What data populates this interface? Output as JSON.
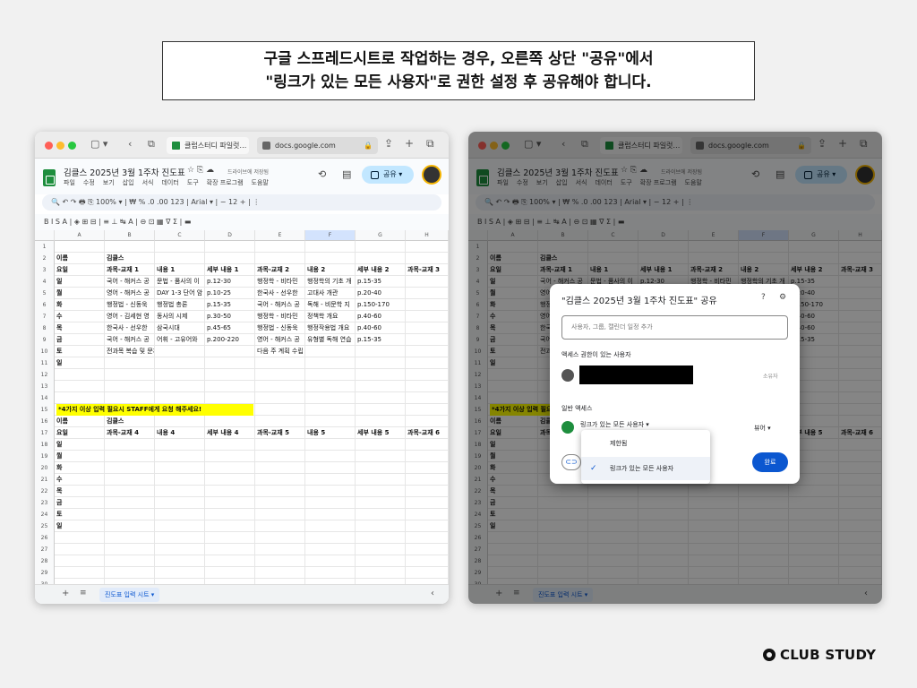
{
  "banner": {
    "line1": "구글 스프레드시트로 작업하는 경우, 오른쪽 상단 \"공유\"에서",
    "line2": "\"링크가 있는 모든 사용자\"로 권한 설정 후 공유해야 합니다."
  },
  "browser": {
    "tab1": "클럽스터디 파일럿…",
    "tab2": "docs.google.com"
  },
  "sheet": {
    "title": "김클스 2025년 3월 1주차 진도표",
    "saved": "드라이브에 저장됨",
    "menus": [
      "파일",
      "수정",
      "보기",
      "삽입",
      "서식",
      "데이터",
      "도구",
      "확장 프로그램",
      "도움말"
    ],
    "share_label": "공유",
    "toolbar1": "🔍  ↶  ↷  🖶  ⎘    100%  ▾  |  ₩  %  .0  .00  123  |  Arial   ▾  |  −  12  +  |  ⋮",
    "toolbar2": "B   I   S   A  |  ◈  ⊞  ⊟  |  ≡  ⊥  ↹  A  |  ⊖  ⊡  ▦  ∇  Σ  |  ▬",
    "cols": [
      "A",
      "B",
      "C",
      "D",
      "E",
      "F",
      "G",
      "H"
    ],
    "rows": [
      {
        "n": "1",
        "c": [
          "",
          "",
          "",
          "",
          "",
          "",
          "",
          ""
        ]
      },
      {
        "n": "2",
        "c": [
          "이름",
          "김클스",
          "",
          "",
          "",
          "",
          "",
          ""
        ]
      },
      {
        "n": "3",
        "c": [
          "요일",
          "과목-교재 1",
          "내용 1",
          "세부 내용 1",
          "과목-교재 2",
          "내용 2",
          "세부 내용 2",
          "과목-교재 3"
        ]
      },
      {
        "n": "4",
        "c": [
          "일",
          "국어 - 해커스 공",
          "문법 - 품사의 이",
          "p.12-30",
          "행정학 - 비타민",
          "행정학의 기초 개",
          "p.15-35",
          ""
        ]
      },
      {
        "n": "5",
        "c": [
          "월",
          "영어 - 해커스 공",
          "DAY 1-3 단어 암",
          "p.10-25",
          "한국사 - 선우한",
          "고대사 개관",
          "p.20-40",
          ""
        ]
      },
      {
        "n": "6",
        "c": [
          "화",
          "행정법 - 신동욱",
          "행정법 총론",
          "p.15-35",
          "국어 - 해커스 공",
          "독해 - 비문학 지",
          "p.150-170",
          ""
        ]
      },
      {
        "n": "7",
        "c": [
          "수",
          "영어 - 김세현 영",
          "동사의 시제",
          "p.30-50",
          "행정학 - 비타민",
          "정책학 개요",
          "p.40-60",
          ""
        ]
      },
      {
        "n": "8",
        "c": [
          "목",
          "한국사 - 선우한",
          "삼국시대",
          "p.45-65",
          "행정법 - 신동욱",
          "행정작용법 개요",
          "p.40-60",
          ""
        ]
      },
      {
        "n": "9",
        "c": [
          "금",
          "국어 - 해커스 공",
          "어휘 - 고유어와",
          "p.200-220",
          "영어 - 해커스 공",
          "유형별 독해 연습",
          "p.15-35",
          ""
        ]
      },
      {
        "n": "10",
        "c": [
          "토",
          "전과목 복습 및 문제풀이",
          "",
          "",
          "다음 주 계획 수립",
          "",
          "",
          ""
        ]
      },
      {
        "n": "11",
        "c": [
          "일",
          "",
          "",
          "",
          "",
          "",
          "",
          ""
        ]
      },
      {
        "n": "12",
        "c": [
          "",
          "",
          "",
          "",
          "",
          "",
          "",
          ""
        ]
      },
      {
        "n": "13",
        "c": [
          "",
          "",
          "",
          "",
          "",
          "",
          "",
          ""
        ]
      },
      {
        "n": "14",
        "c": [
          "",
          "",
          "",
          "",
          "",
          "",
          "",
          ""
        ]
      },
      {
        "n": "15",
        "c": [
          "",
          "",
          "",
          "",
          "",
          "",
          "",
          ""
        ]
      },
      {
        "n": "16",
        "c": [
          "이름",
          "김클스",
          "",
          "",
          "",
          "",
          "",
          ""
        ]
      },
      {
        "n": "17",
        "c": [
          "요일",
          "과목-교재 4",
          "내용 4",
          "세부 내용 4",
          "과목-교재 5",
          "내용 5",
          "세부 내용 5",
          "과목-교재 6"
        ]
      },
      {
        "n": "18",
        "c": [
          "일",
          "",
          "",
          "",
          "",
          "",
          "",
          ""
        ]
      },
      {
        "n": "19",
        "c": [
          "월",
          "",
          "",
          "",
          "",
          "",
          "",
          ""
        ]
      },
      {
        "n": "20",
        "c": [
          "화",
          "",
          "",
          "",
          "",
          "",
          "",
          ""
        ]
      },
      {
        "n": "21",
        "c": [
          "수",
          "",
          "",
          "",
          "",
          "",
          "",
          ""
        ]
      },
      {
        "n": "22",
        "c": [
          "목",
          "",
          "",
          "",
          "",
          "",
          "",
          ""
        ]
      },
      {
        "n": "23",
        "c": [
          "금",
          "",
          "",
          "",
          "",
          "",
          "",
          ""
        ]
      },
      {
        "n": "24",
        "c": [
          "토",
          "",
          "",
          "",
          "",
          "",
          "",
          ""
        ]
      },
      {
        "n": "25",
        "c": [
          "일",
          "",
          "",
          "",
          "",
          "",
          "",
          ""
        ]
      },
      {
        "n": "26",
        "c": [
          "",
          "",
          "",
          "",
          "",
          "",
          "",
          ""
        ]
      },
      {
        "n": "27",
        "c": [
          "",
          "",
          "",
          "",
          "",
          "",
          "",
          ""
        ]
      },
      {
        "n": "28",
        "c": [
          "",
          "",
          "",
          "",
          "",
          "",
          "",
          ""
        ]
      },
      {
        "n": "29",
        "c": [
          "",
          "",
          "",
          "",
          "",
          "",
          "",
          ""
        ]
      },
      {
        "n": "30",
        "c": [
          "",
          "",
          "",
          "",
          "",
          "",
          "",
          ""
        ]
      },
      {
        "n": "31",
        "c": [
          "",
          "",
          "",
          "",
          "",
          "",
          "",
          ""
        ]
      },
      {
        "n": "32",
        "c": [
          "",
          "",
          "",
          "",
          "",
          "",
          "",
          ""
        ]
      },
      {
        "n": "33",
        "c": [
          "",
          "",
          "",
          "",
          "",
          "",
          "",
          ""
        ]
      },
      {
        "n": "34",
        "c": [
          "",
          "",
          "",
          "",
          "",
          "",
          "",
          ""
        ]
      },
      {
        "n": "35",
        "c": [
          "",
          "",
          "",
          "",
          "",
          "",
          "",
          ""
        ]
      },
      {
        "n": "36",
        "c": [
          "",
          "",
          "",
          "",
          "",
          "",
          "",
          ""
        ]
      }
    ],
    "staff_note": "*4가지 이상 입력 필요시 STAFF에게 요청 해주세요!",
    "sheet_tab": "진도표 입력 시트"
  },
  "dialog": {
    "title": "\"김클스 2025년 3월 1주차 진도표\" 공유",
    "input_placeholder": "사용자, 그룹, 캘린더 일정 추가",
    "access_people": "액세스 권한이 있는 사용자",
    "owner": "소유자",
    "general_access": "일반 액세스",
    "access_value": "링크가 있는 모든 사용자",
    "role": "뷰어",
    "done": "완료",
    "options": [
      "제한됨",
      "링크가 있는 모든 사용자"
    ]
  },
  "logo": "CLUB STUDY"
}
